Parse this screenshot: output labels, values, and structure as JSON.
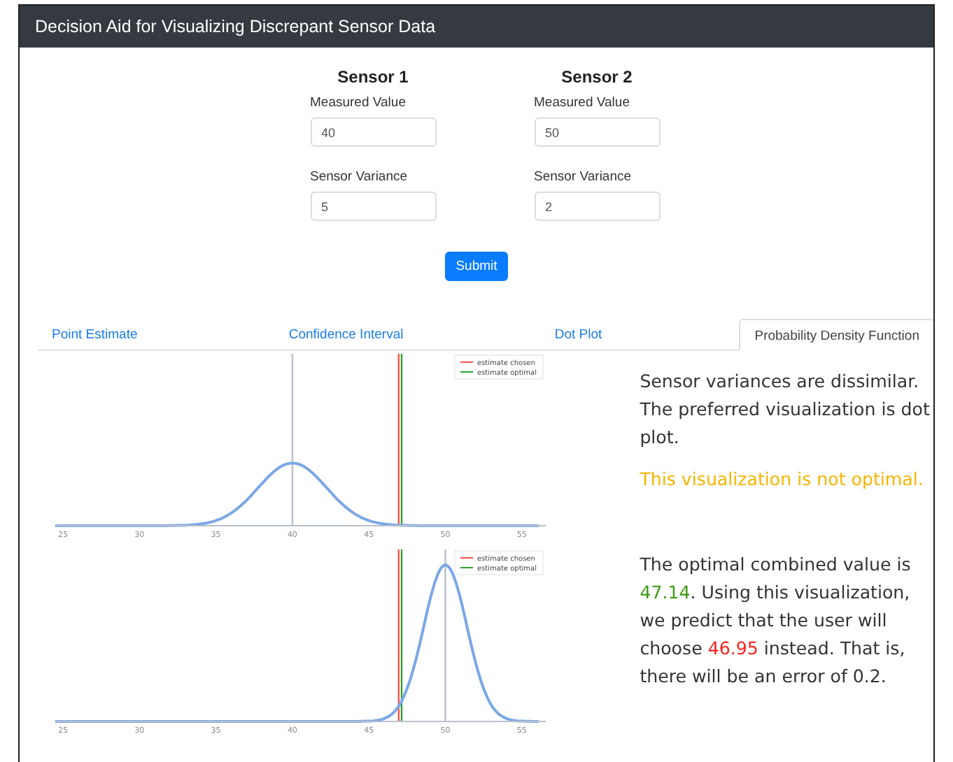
{
  "window": {
    "title": "Decision Aid for Visualizing Discrepant Sensor Data"
  },
  "sensors": [
    {
      "heading": "Sensor 1",
      "value_label": "Measured Value",
      "value": "40",
      "variance_label": "Sensor Variance",
      "variance": "5"
    },
    {
      "heading": "Sensor 2",
      "value_label": "Measured Value",
      "value": "50",
      "variance_label": "Sensor Variance",
      "variance": "2"
    }
  ],
  "submit": "Submit",
  "tabs": [
    {
      "label": "Point Estimate",
      "selected": false
    },
    {
      "label": "Confidence Interval",
      "selected": false
    },
    {
      "label": "Dot Plot",
      "selected": false
    },
    {
      "label": "Probability Density Function",
      "selected": true
    }
  ],
  "plots": [
    {
      "x_tick_labels": [
        "25",
        "30",
        "35",
        "40",
        "45",
        "50",
        "55"
      ],
      "legend": [
        {
          "label": "estimate chosen",
          "kind": "chosen"
        },
        {
          "label": "estimate optimal",
          "kind": "optimal"
        }
      ]
    },
    {
      "x_tick_labels": [
        "25",
        "30",
        "35",
        "40",
        "45",
        "50",
        "55"
      ],
      "legend": [
        {
          "label": "estimate chosen",
          "kind": "chosen"
        },
        {
          "label": "estimate optimal",
          "kind": "optimal"
        }
      ]
    }
  ],
  "panel": {
    "assessment": "Sensor variances are dissimilar. The preferred visualization is dot plot.",
    "warning": "This visualization is not optimal.",
    "result": [
      {
        "kind": "plain",
        "text": "The optimal combined value is "
      },
      {
        "kind": "optimal",
        "text": "47.14"
      },
      {
        "kind": "plain",
        "text": ". Using this visualization, we predict that the user will choose "
      },
      {
        "kind": "chosen",
        "text": "46.95"
      },
      {
        "kind": "plain",
        "text": " instead. That is, there will be an error of 0.2."
      }
    ]
  }
}
